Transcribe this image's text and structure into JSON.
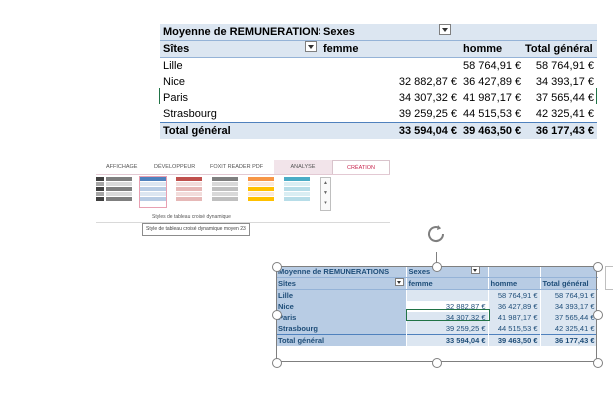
{
  "top_pivot": {
    "title": "Moyenne de REMUNERATIONS",
    "col_field": "Sexes",
    "row_field": "Sîtes",
    "columns": [
      "femme",
      "homme",
      "Total général"
    ],
    "rows": [
      {
        "site": "Lille",
        "femme": "",
        "homme": "58 764,91 €",
        "total": "58 764,91 €"
      },
      {
        "site": "Nice",
        "femme": "32 882,87 €",
        "homme": "36 427,89 €",
        "total": "34 393,17 €"
      },
      {
        "site": "Paris",
        "femme": "34 307,32 €",
        "homme": "41 987,17 €",
        "total": "37 565,44 €"
      },
      {
        "site": "Strasbourg",
        "femme": "39 259,25 €",
        "homme": "44 515,53 €",
        "total": "42 325,41 €"
      }
    ],
    "grand_total": {
      "label": "Total général",
      "femme": "33 594,04 €",
      "homme": "39 463,50 €",
      "total": "36 177,43 €"
    }
  },
  "ribbon": {
    "tabs": [
      "AFFICHAGE",
      "DÉVELOPPEUR",
      "FOXIT READER PDF",
      "ANALYSE",
      "CRÉATION"
    ],
    "gallery_label": "Styles de tableau croisé dynamique",
    "tooltip": "Style de tableau croisé dynamique moyen 23",
    "colors": {
      "accent": "#c8264f",
      "analyse_bg": "#f2e4ea"
    },
    "swatch_colors": [
      "#595959",
      "#7f7f7f",
      "#4f81bd",
      "#c0504d",
      "#9bbb59",
      "#8064a2",
      "#4bacc6",
      "#f79646",
      "#ffc000"
    ]
  },
  "bottom_pivot": {
    "title": "Moyenne de REMUNERATIONS",
    "col_field": "Sexes",
    "row_field": "Sîtes",
    "columns": [
      "femme",
      "homme",
      "Total général"
    ],
    "rows": [
      {
        "site": "Lille",
        "femme": "",
        "homme": "58 764,91 €",
        "total": "58 764,91 €"
      },
      {
        "site": "Nice",
        "femme": "32 882,87 €",
        "homme": "36 427,89 €",
        "total": "34 393,17 €"
      },
      {
        "site": "Paris",
        "femme": "34 307,32 €",
        "homme": "41 987,17 €",
        "total": "37 565,44 €"
      },
      {
        "site": "Strasbourg",
        "femme": "39 259,25 €",
        "homme": "44 515,53 €",
        "total": "42 325,41 €"
      }
    ],
    "grand_total": {
      "label": "Total général",
      "femme": "33 594,04 €",
      "homme": "39 463,50 €",
      "total": "36 177,43 €"
    }
  }
}
